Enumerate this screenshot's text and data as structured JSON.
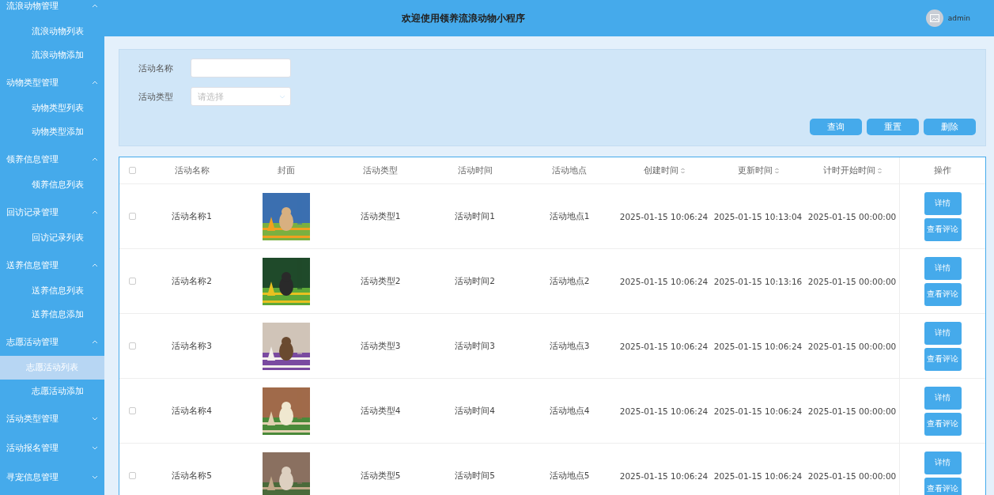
{
  "header": {
    "title": "欢迎使用领养流浪动物小程序",
    "user": "admin"
  },
  "sidebar": [
    {
      "label": "流浪动物管理",
      "expanded": true,
      "children": [
        {
          "label": "流浪动物列表",
          "selected": false
        },
        {
          "label": "流浪动物添加",
          "selected": false
        }
      ]
    },
    {
      "label": "动物类型管理",
      "expanded": true,
      "children": [
        {
          "label": "动物类型列表",
          "selected": false
        },
        {
          "label": "动物类型添加",
          "selected": false
        }
      ]
    },
    {
      "label": "领养信息管理",
      "expanded": true,
      "children": [
        {
          "label": "领养信息列表",
          "selected": false
        }
      ]
    },
    {
      "label": "回访记录管理",
      "expanded": true,
      "children": [
        {
          "label": "回访记录列表",
          "selected": false
        }
      ]
    },
    {
      "label": "送养信息管理",
      "expanded": true,
      "children": [
        {
          "label": "送养信息列表",
          "selected": false
        },
        {
          "label": "送养信息添加",
          "selected": false
        }
      ]
    },
    {
      "label": "志愿活动管理",
      "expanded": true,
      "children": [
        {
          "label": "志愿活动列表",
          "selected": true
        },
        {
          "label": "志愿活动添加",
          "selected": false
        }
      ]
    },
    {
      "label": "活动类型管理",
      "expanded": false
    },
    {
      "label": "活动报名管理",
      "expanded": false
    },
    {
      "label": "寻宠信息管理",
      "expanded": false
    }
  ],
  "search": {
    "fields": [
      {
        "label": "活动名称",
        "kind": "input"
      },
      {
        "label": "活动类型",
        "kind": "select",
        "placeholder": "请选择"
      }
    ],
    "buttons": [
      "查询",
      "重置",
      "删除"
    ]
  },
  "table": {
    "all_checked": false,
    "columns": [
      {
        "label": "活动名称",
        "sortable": false
      },
      {
        "label": "封面",
        "sortable": false
      },
      {
        "label": "活动类型",
        "sortable": false
      },
      {
        "label": "活动时间",
        "sortable": false
      },
      {
        "label": "活动地点",
        "sortable": false
      },
      {
        "label": "创建时间",
        "sortable": true
      },
      {
        "label": "更新时间",
        "sortable": true
      },
      {
        "label": "计时开始时间",
        "sortable": true
      },
      {
        "label": "操作",
        "sortable": false
      }
    ],
    "rows": [
      {
        "checked": false,
        "name": "活动名称1",
        "type": "活动类型1",
        "time": "活动时间1",
        "place": "活动地点1",
        "created": "2025-01-15 10:06:24",
        "updated": "2025-01-15 10:13:04",
        "start": "2025-01-15 00:00:00",
        "actions": [
          "详情",
          "查看评论"
        ]
      },
      {
        "checked": false,
        "name": "活动名称2",
        "type": "活动类型2",
        "time": "活动时间2",
        "place": "活动地点2",
        "created": "2025-01-15 10:06:24",
        "updated": "2025-01-15 10:13:16",
        "start": "2025-01-15 00:00:00",
        "actions": [
          "详情",
          "查看评论"
        ]
      },
      {
        "checked": false,
        "name": "活动名称3",
        "type": "活动类型3",
        "time": "活动时间3",
        "place": "活动地点3",
        "created": "2025-01-15 10:06:24",
        "updated": "2025-01-15 10:06:24",
        "start": "2025-01-15 00:00:00",
        "actions": [
          "详情",
          "查看评论"
        ]
      },
      {
        "checked": false,
        "name": "活动名称4",
        "type": "活动类型4",
        "time": "活动时间4",
        "place": "活动地点4",
        "created": "2025-01-15 10:06:24",
        "updated": "2025-01-15 10:06:24",
        "start": "2025-01-15 00:00:00",
        "actions": [
          "详情",
          "查看评论"
        ]
      },
      {
        "checked": false,
        "name": "活动名称5",
        "type": "活动类型5",
        "time": "活动时间5",
        "place": "活动地点5",
        "created": "2025-01-15 10:06:24",
        "updated": "2025-01-15 10:06:24",
        "start": "2025-01-15 00:00:00",
        "actions": [
          "详情",
          "查看评论"
        ]
      }
    ]
  }
}
